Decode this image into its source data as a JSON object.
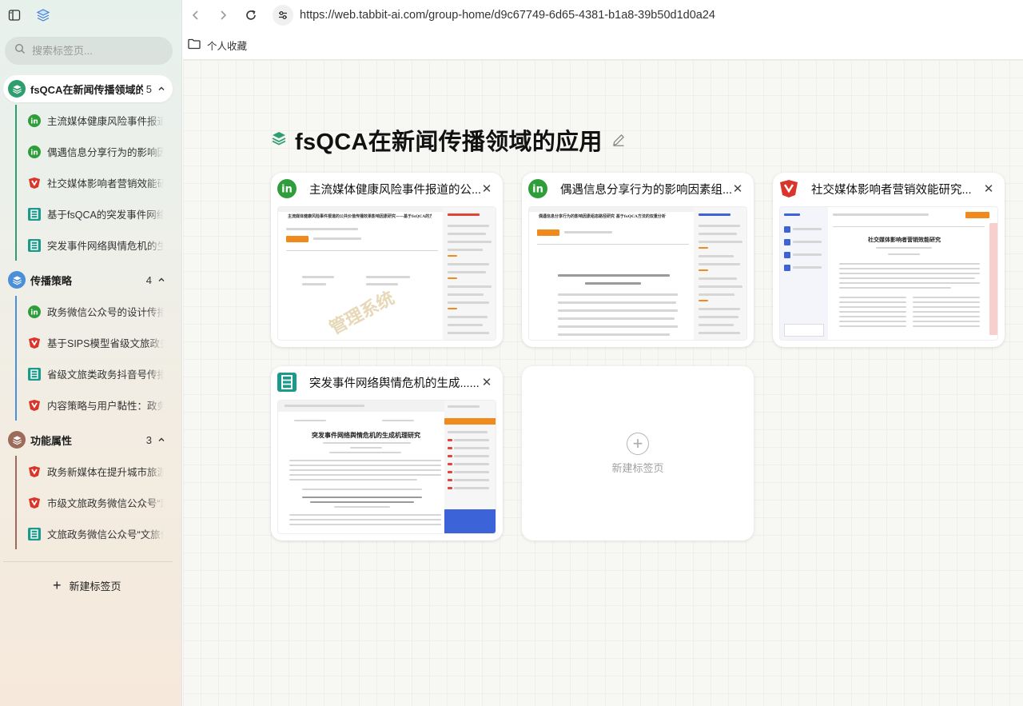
{
  "sidebar": {
    "search_placeholder": "搜索标签页...",
    "groups": [
      {
        "title": "fsQCA在新闻传播领域的应用",
        "count": "5",
        "icon": "stack-icon",
        "color": "#2f9e6e",
        "tabs": [
          {
            "label": "主流媒体健康风险事件报道的公共",
            "favicon": "in-icon"
          },
          {
            "label": "偶遇信息分享行为的影响因素组态",
            "favicon": "in-icon"
          },
          {
            "label": "社交媒体影响者营销效能研究——",
            "favicon": "cnki-icon"
          },
          {
            "label": "基于fsQCA的突发事件网络舆情",
            "favicon": "dao-icon"
          },
          {
            "label": "突发事件网络舆情危机的生成机理",
            "favicon": "dao-icon"
          }
        ]
      },
      {
        "title": "传播策略",
        "count": "4",
        "icon": "stack-icon",
        "color": "#4a8fd8",
        "tabs": [
          {
            "label": "政务微信公众号的设计传播策略",
            "favicon": "in-icon"
          },
          {
            "label": "基于SIPS模型省级文旅政务微信",
            "favicon": "cnki-icon"
          },
          {
            "label": "省级文旅类政务抖音号传播效果",
            "favicon": "dao-icon"
          },
          {
            "label": "内容策略与用户黏性：政务微信",
            "favicon": "cnki-icon"
          }
        ]
      },
      {
        "title": "功能属性",
        "count": "3",
        "icon": "stack-icon",
        "color": "#9c6b5a",
        "tabs": [
          {
            "label": "政务新媒体在提升城市旅游形象",
            "favicon": "cnki-icon"
          },
          {
            "label": "市级文旅政务微信公众号“跨界",
            "favicon": "cnki-icon"
          },
          {
            "label": "文旅政务微信公众号“文旅供给",
            "favicon": "dao-icon"
          }
        ]
      }
    ],
    "new_tab_label": "新建标签页"
  },
  "browser": {
    "url": "https://web.tabbit-ai.com/group-home/d9c67749-6d65-4381-b1a8-39b50d1d0a24",
    "bookmark": "个人收藏"
  },
  "main": {
    "title": "fsQCA在新闻传播领域的应用",
    "cards": [
      {
        "title": "主流媒体健康风险事件报道的公...",
        "favicon": "in-icon",
        "thumb_heading": "主流媒体健康风险事件报道的公共价值传播效果影响因素研究——基于fsQCA的方法"
      },
      {
        "title": "偶遇信息分享行为的影响因素组...",
        "favicon": "in-icon",
        "thumb_heading": "偶遇信息分享行为的影响因素组态路径研究 基于fsQCA方法的双重分析"
      },
      {
        "title": "社交媒体影响者营销效能研究...",
        "favicon": "cnki-icon",
        "thumb_heading": "社交媒体影响者营销效能研究"
      },
      {
        "title": "突发事件网络舆情危机的生成......",
        "favicon": "dao-icon",
        "thumb_heading": "突发事件网络舆情危机的生成机理研究"
      }
    ],
    "new_card_label": "新建标签页"
  },
  "colors": {
    "in_green": "#2e9d3a",
    "cnki_red": "#d9352b",
    "dao_teal": "#1a9a8a",
    "accent_orange": "#f08a1c"
  }
}
